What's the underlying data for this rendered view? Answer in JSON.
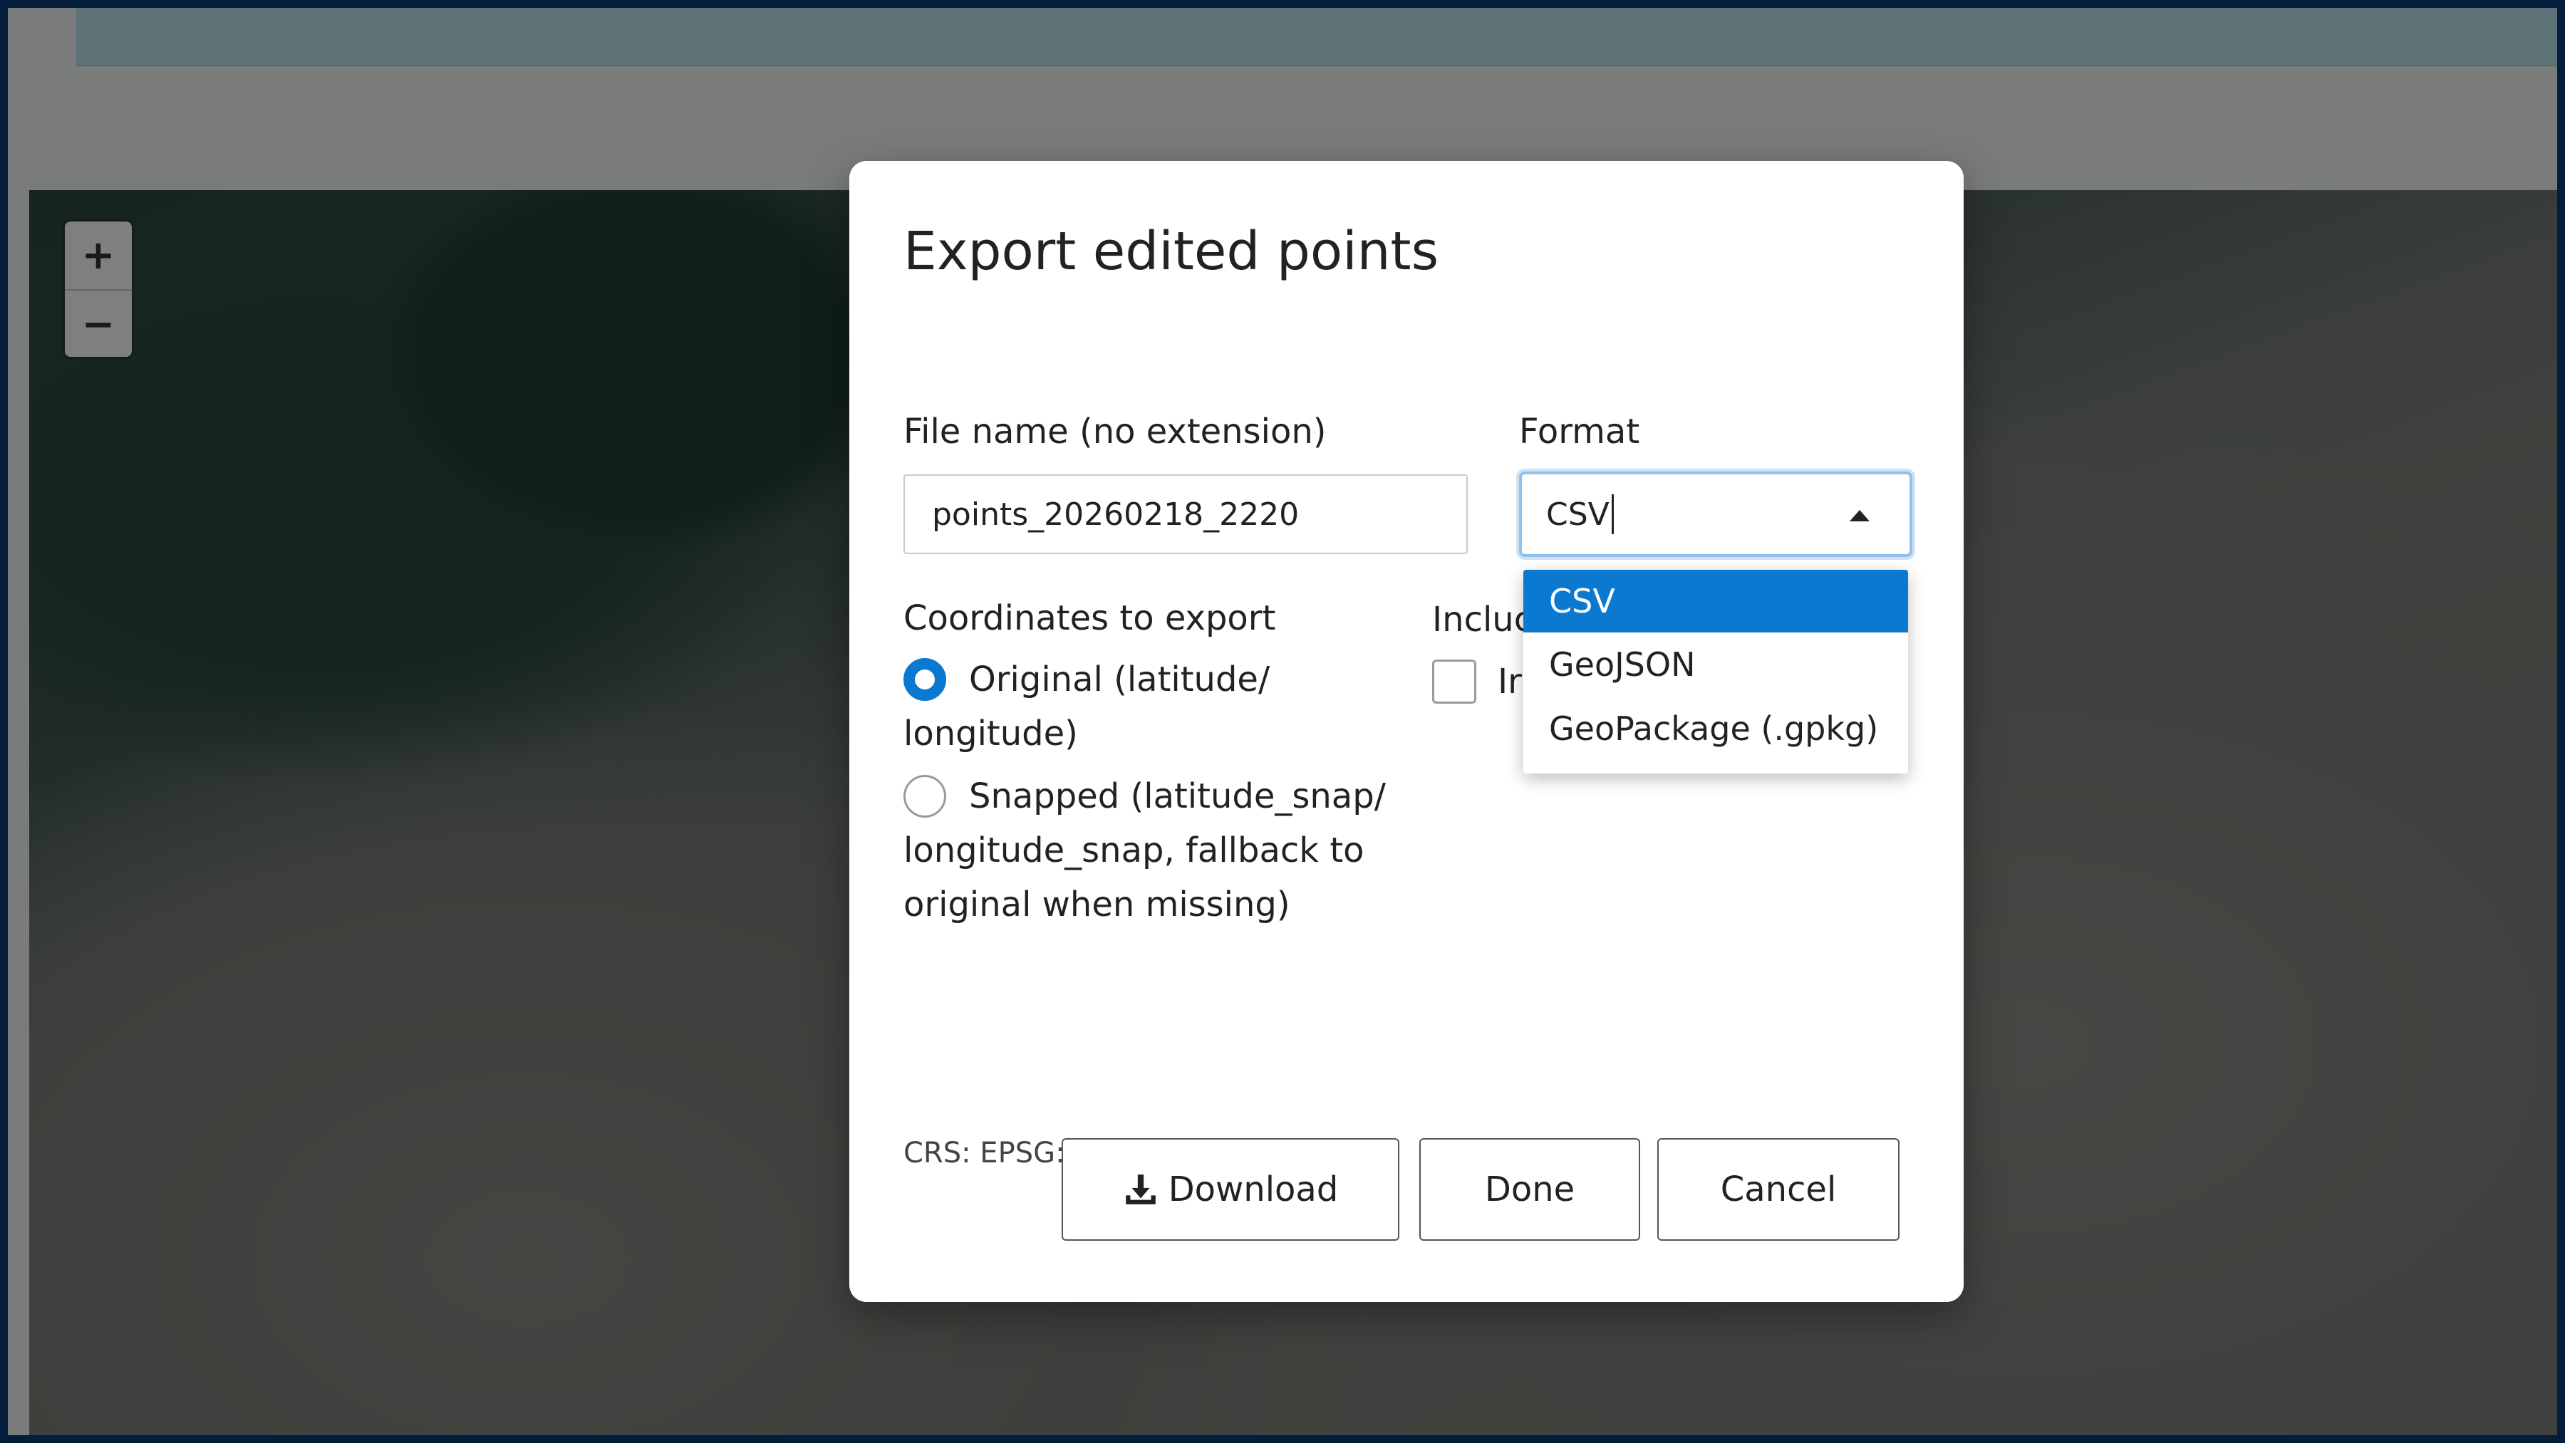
{
  "modal": {
    "title": "Export edited points",
    "file_name": {
      "label": "File name (no extension)",
      "value": "points_20260218_2220"
    },
    "format": {
      "label": "Format",
      "selected": "CSV",
      "options": [
        "CSV",
        "GeoJSON",
        "GeoPackage (.gpkg)"
      ]
    },
    "coordinates": {
      "label": "Coordinates to export",
      "original": {
        "line1": "Original (latitude/",
        "line2": "longitude)"
      },
      "snapped": {
        "line1": "Snapped (latitude_snap/",
        "line2": "longitude_snap, fallback to",
        "line3": "original when missing)"
      }
    },
    "include": {
      "label": "Incluc",
      "item_label": "Ir"
    },
    "crs_note": "CRS: EPSG:4326 (WGS 84).",
    "buttons": {
      "download": "Download",
      "done": "Done",
      "cancel": "Cancel"
    }
  },
  "map": {
    "zoom_in": "+",
    "zoom_out": "−"
  },
  "colors": {
    "accent": "#0b79d0",
    "frame": "#0a3a78",
    "banner": "#b9e4ee"
  }
}
